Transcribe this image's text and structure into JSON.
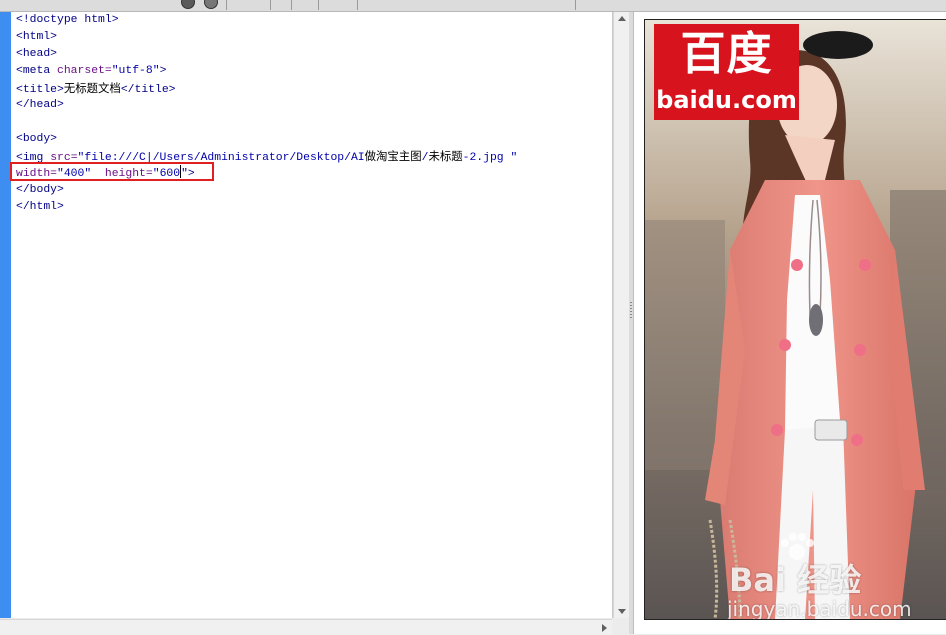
{
  "editor": {
    "lines": [
      [
        {
          "t": "<!doctype html>",
          "c": "tag"
        }
      ],
      [
        {
          "t": "<html>",
          "c": "tag"
        }
      ],
      [
        {
          "t": "<head>",
          "c": "tag"
        }
      ],
      [
        {
          "t": "<meta ",
          "c": "tag"
        },
        {
          "t": "charset=",
          "c": "attr"
        },
        {
          "t": "\"utf-8\"",
          "c": "val"
        },
        {
          "t": ">",
          "c": "tag"
        }
      ],
      [
        {
          "t": "<title>",
          "c": "tag"
        },
        {
          "t": "无标题文档",
          "c": "txt"
        },
        {
          "t": "</title>",
          "c": "tag"
        }
      ],
      [
        {
          "t": "</head>",
          "c": "tag"
        }
      ],
      [],
      [
        {
          "t": "<body>",
          "c": "tag"
        }
      ],
      [
        {
          "t": "<img ",
          "c": "tag"
        },
        {
          "t": "src=",
          "c": "attr"
        },
        {
          "t": "\"file:///C|/Users/Administrator/Desktop/AI",
          "c": "val"
        },
        {
          "t": "做淘宝主图",
          "c": "txt"
        },
        {
          "t": "/",
          "c": "val"
        },
        {
          "t": "未标题",
          "c": "txt"
        },
        {
          "t": "-2.jpg \"",
          "c": "val"
        }
      ],
      [
        {
          "t": "width=",
          "c": "attr"
        },
        {
          "t": "\"400\"",
          "c": "val"
        },
        {
          "t": "  height=",
          "c": "attr"
        },
        {
          "t": "\"600",
          "c": "val"
        },
        {
          "t": "",
          "c": "caret"
        },
        {
          "t": "\"",
          "c": "val"
        },
        {
          "t": ">",
          "c": "tag"
        }
      ],
      [
        {
          "t": "</body>",
          "c": "tag"
        }
      ],
      [
        {
          "t": "</html>",
          "c": "tag"
        }
      ]
    ]
  },
  "preview": {
    "logo_cn": "百度",
    "logo_en": "baidu.com",
    "watermark_main": "Bai 经验",
    "watermark_url": "jingyan.baidu.com"
  },
  "colors": {
    "gutter": "#3d8ef0",
    "highlight": "#e02020",
    "baidu_red": "#d7141d",
    "cardigan": "#e8897e"
  }
}
